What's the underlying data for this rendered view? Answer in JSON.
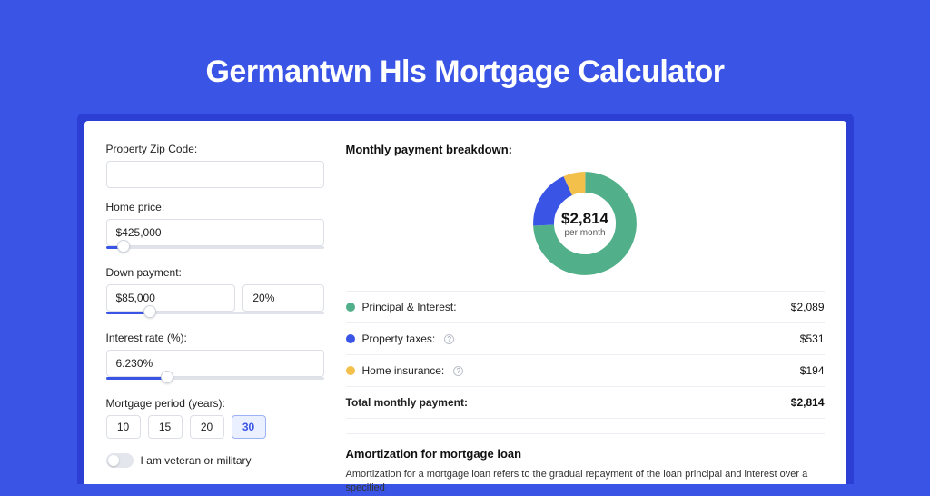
{
  "colors": {
    "principal": "#51b08a",
    "taxes": "#3a55e6",
    "insurance": "#f3c04b",
    "accent": "#3a55e6"
  },
  "header": {
    "title": "Germantwn Hls Mortgage Calculator"
  },
  "form": {
    "zip_label": "Property Zip Code:",
    "zip_value": "",
    "home_price_label": "Home price:",
    "home_price_value": "$425,000",
    "home_price_pct": 8,
    "down_label": "Down payment:",
    "down_value": "$85,000",
    "down_pct_value": "20%",
    "down_pct": 20,
    "rate_label": "Interest rate (%):",
    "rate_value": "6.230%",
    "rate_pct": 28,
    "period_label": "Mortgage period (years):",
    "periods": [
      "10",
      "15",
      "20",
      "30"
    ],
    "period_active_index": 3,
    "veteran_label": "I am veteran or military"
  },
  "breakdown": {
    "heading": "Monthly payment breakdown:",
    "center_amount": "$2,814",
    "center_sub": "per month",
    "items": [
      {
        "label": "Principal & Interest:",
        "value": "$2,089",
        "color": "#51b08a",
        "info": false,
        "pct": 74.2
      },
      {
        "label": "Property taxes:",
        "value": "$531",
        "color": "#3a55e6",
        "info": true,
        "pct": 18.9
      },
      {
        "label": "Home insurance:",
        "value": "$194",
        "color": "#f3c04b",
        "info": true,
        "pct": 6.9
      }
    ],
    "total_label": "Total monthly payment:",
    "total_value": "$2,814"
  },
  "amortization": {
    "title": "Amortization for mortgage loan",
    "text": "Amortization for a mortgage loan refers to the gradual repayment of the loan principal and interest over a specified"
  },
  "chart_data": {
    "type": "pie",
    "title": "Monthly payment breakdown",
    "categories": [
      "Principal & Interest",
      "Property taxes",
      "Home insurance"
    ],
    "values": [
      2089,
      531,
      194
    ],
    "total": 2814,
    "unit": "USD/month"
  }
}
